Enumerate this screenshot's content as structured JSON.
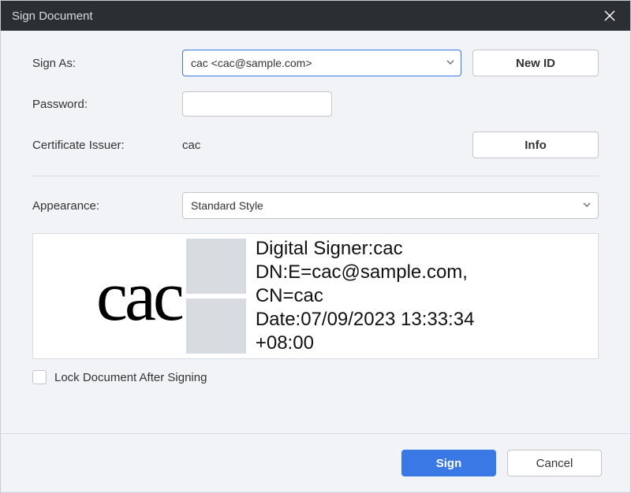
{
  "titlebar": {
    "title": "Sign Document"
  },
  "labels": {
    "sign_as": "Sign As:",
    "password": "Password:",
    "cert_issuer": "Certificate Issuer:",
    "appearance": "Appearance:"
  },
  "fields": {
    "sign_as_value": "cac <cac@sample.com>",
    "password_value": "",
    "cert_issuer_value": "cac",
    "appearance_value": "Standard Style"
  },
  "buttons": {
    "new_id": "New ID",
    "info": "Info",
    "sign": "Sign",
    "cancel": "Cancel"
  },
  "preview": {
    "name": "cac",
    "line1": "Digital Signer:cac",
    "line2": "DN:E=cac@sample.com,",
    "line3": "CN=cac",
    "line4": "Date:07/09/2023 13:33:34",
    "line5": "+08:00"
  },
  "lock": {
    "label": "Lock Document After Signing",
    "checked": false
  }
}
